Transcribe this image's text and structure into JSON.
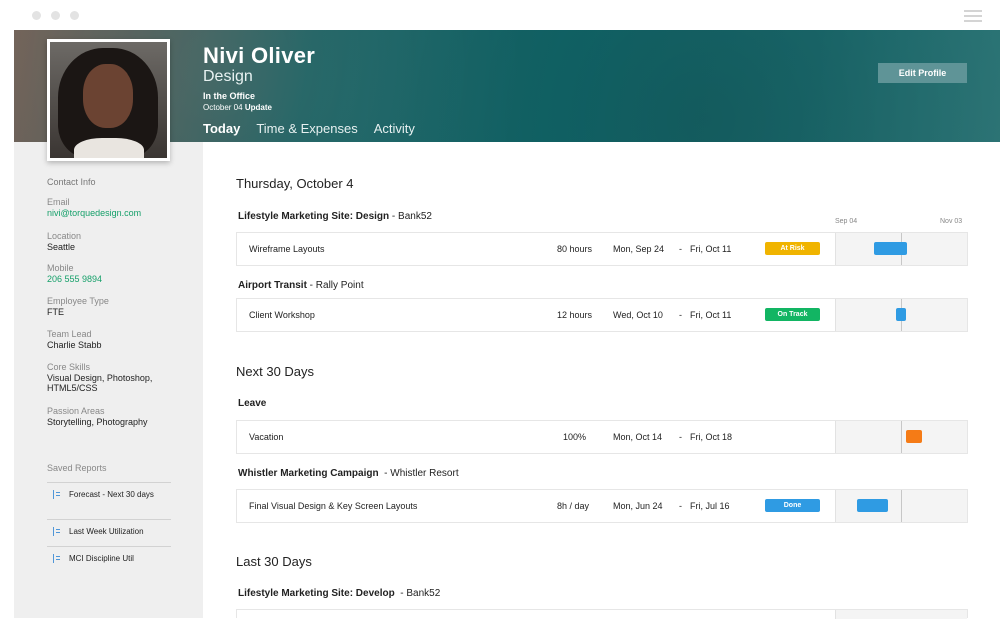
{
  "header": {
    "name": "Nivi Oliver",
    "role": "Design",
    "status": "In the Office",
    "update_date": "October 04",
    "update_label": "Update",
    "edit_label": "Edit Profile",
    "tabs": [
      {
        "label": "Today",
        "active": true
      },
      {
        "label": "Time & Expenses",
        "active": false
      },
      {
        "label": "Activity",
        "active": false
      }
    ]
  },
  "sidebar": {
    "contact_title": "Contact Info",
    "fields": [
      {
        "label": "Email",
        "value": "nivi@torquedesign.com"
      },
      {
        "label": "Location",
        "value": "Seattle"
      },
      {
        "label": "Mobile",
        "value": "206 555 9894"
      },
      {
        "label": "Employee Type",
        "value": "FTE"
      },
      {
        "label": "Team Lead",
        "value": "Charlie Stabb"
      },
      {
        "label": "Core Skills",
        "value": "Visual Design, Photoshop, HTML5/CSS"
      },
      {
        "label": "Passion Areas",
        "value": "Storytelling, Photography"
      }
    ],
    "saved_title": "Saved Reports",
    "reports": [
      "Forecast - Next 30 days",
      "Last Week Utilization",
      "MCI Discipline Util"
    ]
  },
  "main": {
    "timeline_start": "Sep 04",
    "timeline_end": "Nov 03",
    "sections": [
      {
        "title": "Thursday, October 4"
      },
      {
        "title": "Next 30 Days"
      },
      {
        "title": "Last 30 Days"
      }
    ],
    "groups": [
      {
        "project": "Lifestyle Marketing Site: Design",
        "client": "Bank52"
      },
      {
        "project": "Airport Transit",
        "client": "Rally Point"
      },
      {
        "project": "Leave",
        "client": ""
      },
      {
        "project": "Whistler Marketing Campaign",
        "client": "Whistler Resort"
      },
      {
        "project": "Lifestyle Marketing Site: Develop",
        "client": "Bank52"
      }
    ],
    "rows": [
      {
        "task": "Wireframe Layouts",
        "amount": "80 hours",
        "start": "Mon, Sep 24",
        "end": "Fri, Oct 11",
        "badge": "At Risk"
      },
      {
        "task": "Client Workshop",
        "amount": "12 hours",
        "start": "Wed, Oct 10",
        "end": "Fri, Oct 11",
        "badge": "On Track"
      },
      {
        "task": "Vacation",
        "amount": "100%",
        "start": "Mon, Oct 14",
        "end": "Fri, Oct 18",
        "badge": ""
      },
      {
        "task": "Final Visual Design & Key Screen Layouts",
        "amount": "8h / day",
        "start": "Mon, Jun 24",
        "end": "Fri, Jul 16",
        "badge": "Done"
      }
    ],
    "date_separator": "-"
  },
  "colors": {
    "at_risk": "#f0b400",
    "on_track": "#12b563",
    "done": "#2f9be3",
    "bar_blue": "#2f9be3",
    "bar_orange": "#f57b16",
    "link_green": "#16a06a"
  }
}
